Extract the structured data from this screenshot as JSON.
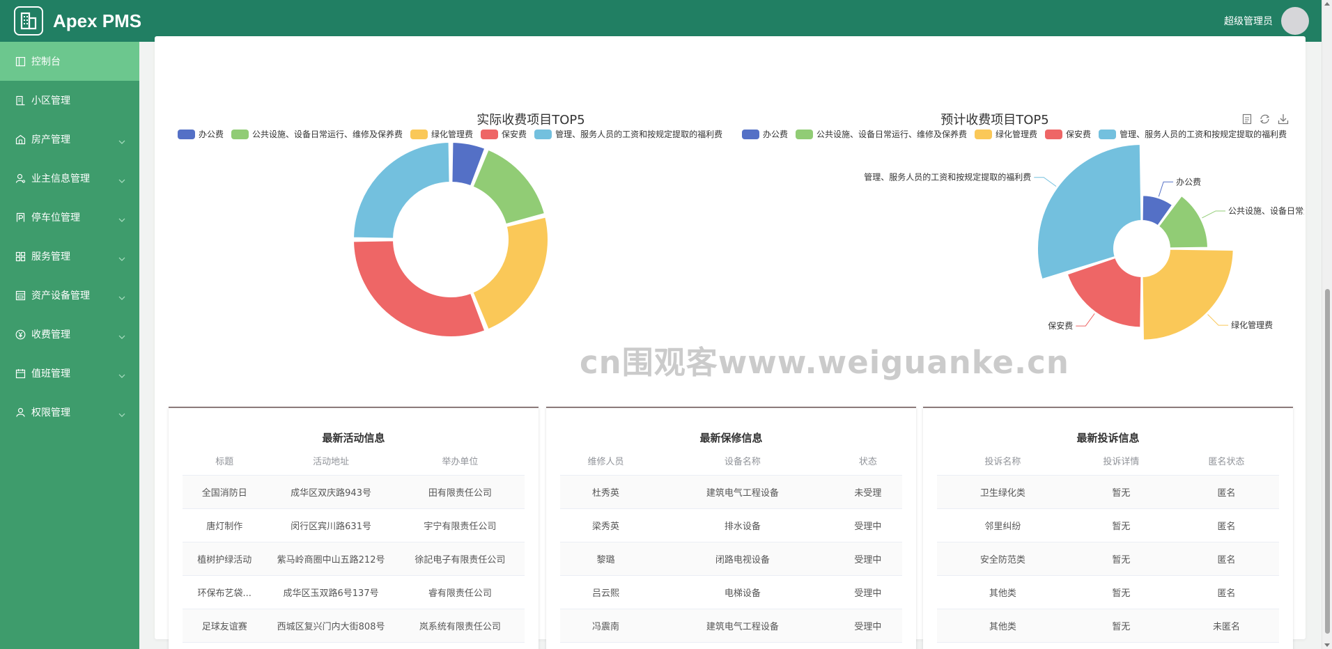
{
  "app": {
    "title": "Apex PMS"
  },
  "user": {
    "name": "超级管理员"
  },
  "sidebar": {
    "items": [
      {
        "label": "控制台",
        "icon": "dashboard-icon",
        "expandable": false
      },
      {
        "label": "小区管理",
        "icon": "building-icon",
        "expandable": false
      },
      {
        "label": "房产管理",
        "icon": "house-icon",
        "expandable": true
      },
      {
        "label": "业主信息管理",
        "icon": "user-settings-icon",
        "expandable": true
      },
      {
        "label": "停车位管理",
        "icon": "parking-icon",
        "expandable": true
      },
      {
        "label": "服务管理",
        "icon": "grid-icon",
        "expandable": true
      },
      {
        "label": "资产设备管理",
        "icon": "asset-icon",
        "expandable": true
      },
      {
        "label": "收费管理",
        "icon": "yen-icon",
        "expandable": true
      },
      {
        "label": "值班管理",
        "icon": "calendar-icon",
        "expandable": true
      },
      {
        "label": "权限管理",
        "icon": "user-icon",
        "expandable": true
      }
    ]
  },
  "colors": {
    "header": "#217f63",
    "sidebar": "#3e9c6c",
    "sidebar_active": "#6cc78e",
    "series": [
      "#5470c6",
      "#91cc75",
      "#fac858",
      "#ee6666",
      "#73c0de"
    ]
  },
  "watermark": "cn围观客www.weiguanke.cn",
  "chart_data": [
    {
      "type": "pie",
      "variant": "donut",
      "title": "实际收费项目TOP5",
      "legend": [
        "办公费",
        "公共设施、设备日常运行、维修及保养费",
        "绿化管理费",
        "保安费",
        "管理、服务人员的工资和按规定提取的福利费"
      ],
      "values": [
        6,
        15,
        23,
        31,
        25
      ],
      "labels_shown": false
    },
    {
      "type": "pie",
      "variant": "rose",
      "title": "预计收费项目TOP5",
      "legend": [
        "办公费",
        "公共设施、设备日常运行、维修及保养费",
        "绿化管理费",
        "保安费",
        "管理、服务人员的工资和按规定提取的福利费"
      ],
      "values": [
        10,
        15,
        25,
        20,
        30
      ],
      "labels_shown": true
    }
  ],
  "toolbox": [
    "data-view-icon",
    "restore-icon",
    "download-icon"
  ],
  "activities": {
    "title": "最新活动信息",
    "columns": [
      "标题",
      "活动地址",
      "举办单位"
    ],
    "rows": [
      [
        "全国消防日",
        "成华区双庆路943号",
        "田有限责任公司"
      ],
      [
        "唐灯制作",
        "闵行区宾川路631号",
        "宇宁有限责任公司"
      ],
      [
        "植树护绿活动",
        "紫马岭商圈中山五路212号",
        "徐記电子有限责任公司"
      ],
      [
        "环保布艺袋...",
        "成华区玉双路6号137号",
        "睿有限责任公司"
      ],
      [
        "足球友谊赛",
        "西城区复兴门内大街808号",
        "岚系统有限责任公司"
      ]
    ]
  },
  "repairs": {
    "title": "最新保修信息",
    "columns": [
      "维修人员",
      "设备名称",
      "状态"
    ],
    "rows": [
      [
        "杜秀英",
        "建筑电气工程设备",
        "未受理"
      ],
      [
        "梁秀英",
        "排水设备",
        "受理中"
      ],
      [
        "黎璐",
        "闭路电视设备",
        "受理中"
      ],
      [
        "吕云熙",
        "电梯设备",
        "受理中"
      ],
      [
        "冯震南",
        "建筑电气工程设备",
        "受理中"
      ]
    ]
  },
  "complaints": {
    "title": "最新投诉信息",
    "columns": [
      "投诉名称",
      "投诉详情",
      "匿名状态"
    ],
    "rows": [
      [
        "卫生绿化类",
        "暂无",
        "匿名"
      ],
      [
        "邻里纠纷",
        "暂无",
        "匿名"
      ],
      [
        "安全防范类",
        "暂无",
        "匿名"
      ],
      [
        "其他类",
        "暂无",
        "匿名"
      ],
      [
        "其他类",
        "暂无",
        "未匿名"
      ]
    ]
  }
}
